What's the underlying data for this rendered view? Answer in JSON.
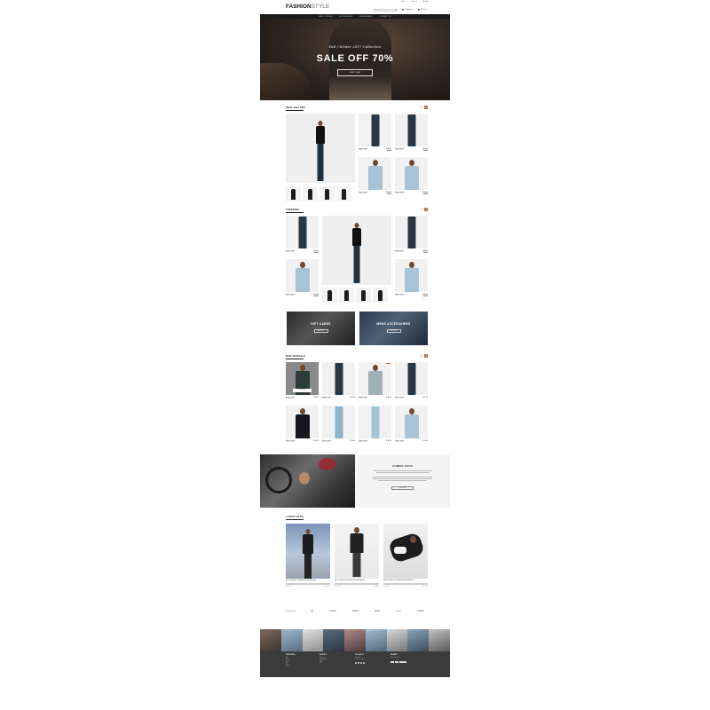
{
  "header": {
    "top_links": [
      "Log in",
      "Sign up",
      "Wishlist"
    ],
    "logo_bold": "FASHION",
    "logo_light": "STYLE",
    "search_placeholder": "Search...",
    "account_label": "My Account",
    "cart_label": "My Cart"
  },
  "nav": {
    "items": [
      "MEN CLOTHING",
      "ACCESSORIES",
      "NEW ARRIVALS",
      "CONTACT US"
    ]
  },
  "hero": {
    "subtitle": "Fall / Winter 2017 Collection",
    "title": "SALE OFF 70%",
    "button": "SHOP NOW"
  },
  "best_sellers": {
    "title": "BEST SELLERS",
    "prev": "‹",
    "next": "›",
    "products": [
      {
        "name": "Stretch jacket",
        "brand": "Fashion Style",
        "price": "$ 30.00",
        "old": "$ 45.00"
      },
      {
        "name": "Stretch jacket",
        "brand": "Fashion Style",
        "price": "$ 30.00",
        "old": "$ 45.00"
      },
      {
        "name": "Stretch jacket",
        "brand": "Fashion Style",
        "price": "$ 30.00",
        "old": "$ 45.00"
      },
      {
        "name": "Stretch jacket",
        "brand": "Fashion Style",
        "price": "$ 30.00",
        "old": "$ 45.00"
      }
    ]
  },
  "trending": {
    "title": "TRENDING",
    "prev": "‹",
    "next": "›",
    "products": [
      {
        "name": "Stretch jacket",
        "brand": "Fashion Style",
        "price": "$ 30.00",
        "old": "$ 45.00"
      },
      {
        "name": "Stretch jacket",
        "brand": "Fashion Style",
        "price": "$ 30.00",
        "old": "$ 45.00"
      },
      {
        "name": "Stretch jacket",
        "brand": "Fashion Style",
        "price": "$ 30.00",
        "old": "$ 45.00"
      },
      {
        "name": "Stretch jacket",
        "brand": "Fashion Style",
        "price": "$ 30.00",
        "old": "$ 45.00"
      }
    ]
  },
  "banners": {
    "gift": {
      "title": "GIFT CARDS",
      "button": "SHOP NOW"
    },
    "accessories": {
      "title": "MENS ACCESSORIES",
      "button": "SHOP NOW"
    }
  },
  "new_arrivals": {
    "title": "NEW ARRIVALS",
    "prev": "‹",
    "next": "›",
    "quick_view": "QUICK VIEW",
    "sale_badge": "SALE",
    "products": [
      {
        "name": "Stretch jacket",
        "brand": "Fashion Style",
        "price": "$ 30.00"
      },
      {
        "name": "Stretch jacket",
        "brand": "Fashion Style",
        "price": "$ 30.00"
      },
      {
        "name": "Stretch jacket",
        "brand": "Fashion Style",
        "price": "$ 30.00"
      },
      {
        "name": "Stretch jacket",
        "brand": "Fashion Style",
        "price": "$ 30.00"
      },
      {
        "name": "Stretch jacket",
        "brand": "Fashion Style",
        "price": "$ 30.00"
      },
      {
        "name": "Stretch jacket",
        "brand": "Fashion Style",
        "price": "$ 30.00"
      },
      {
        "name": "Stretch jacket",
        "brand": "Fashion Style",
        "price": "$ 30.00"
      },
      {
        "name": "Stretch jacket",
        "brand": "Fashion Style",
        "price": "$ 30.00"
      }
    ]
  },
  "coming_soon": {
    "title": "COMING SOON",
    "button": "SHOP NOW"
  },
  "blog": {
    "title": "LATEST BLOG",
    "posts": [
      {
        "title": "Mens Instagrams That Make A Strong Difference",
        "date": "May 20, 2017",
        "more": "Read more"
      },
      {
        "title": "Mens Instagrams That Make A Strong Difference",
        "date": "May 20, 2017",
        "more": "Read more"
      },
      {
        "title": "Mens Instagrams That Make A Strong Difference",
        "date": "May 20, 2017",
        "more": "Read more"
      }
    ]
  },
  "brands": [
    "Signature",
    "◉",
    "CLINCH",
    "SAVILE",
    "BOSS",
    "Hemp",
    "CLINCH"
  ],
  "footer": {
    "col1": {
      "heading": "CATEGORIES",
      "links": [
        "Men",
        "Jackets",
        "Jeans",
        "Shirts",
        "Shoes",
        "Sale"
      ]
    },
    "col2": {
      "heading": "SUPPORT",
      "links": [
        "Contact us",
        "Shipping policy",
        "Returns",
        "FAQ"
      ]
    },
    "col3": {
      "heading": "FOLLOW US",
      "links": [
        "Newsletter",
        "Sign up for updates"
      ]
    },
    "col4": {
      "heading": "PAYMENT",
      "links": [
        "Secure payment"
      ]
    }
  },
  "colors": {
    "accent": "#b0774d",
    "dark": "#1b1b1b",
    "footer": "#3b3b3b"
  }
}
